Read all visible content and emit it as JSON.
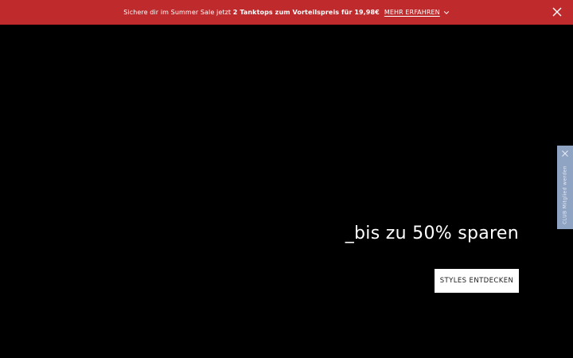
{
  "promo": {
    "text_before": "Sichere dir im Summer Sale jetzt ",
    "text_bold": "2 Tanktops zum Vorteilspreis für 19,98€",
    "link_label": "MEHR ERFAHREN",
    "chevron_icon": "chevron-down-icon",
    "close_icon": "close-icon",
    "background_color": "#bf2a2c"
  },
  "hero": {
    "headline": "_bis zu 50% sparen",
    "cta_label": "STYLES ENTDECKEN",
    "background_color": "#000000"
  },
  "side_tab": {
    "label": "CLUB Mitglied werden",
    "close_icon": "close-icon",
    "background_color": "#8fa3c3"
  }
}
